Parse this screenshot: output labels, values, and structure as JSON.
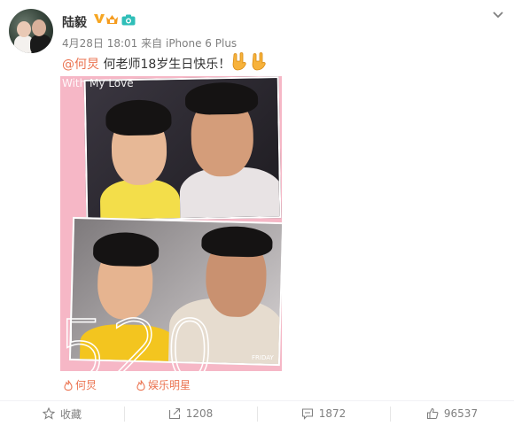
{
  "user": {
    "name": "陆毅",
    "verified_icon": "verified-v-icon",
    "level_icon": "vip-level-icon",
    "camera_icon": "camera-icon",
    "colors": {
      "verified": "#f6a623",
      "camera": "#2fbeb8"
    }
  },
  "post": {
    "date": "4月28日 18:01",
    "via_prefix": "来自",
    "device": "iPhone 6 Plus",
    "mention": "@何炅",
    "text": " 何老师18岁生日快乐！",
    "emojis": [
      "rock-hand-emoji-icon",
      "rock-hand-emoji-icon"
    ],
    "image": {
      "caption": "With My Love",
      "big_number": "520",
      "day": "FRIDAY",
      "background": "#f6b7c6"
    },
    "tags": [
      {
        "icon": "flame-icon",
        "label": "何炅"
      },
      {
        "icon": "flame-icon",
        "label": "娱乐明星"
      }
    ]
  },
  "actions": {
    "favorite": {
      "icon": "star-icon",
      "label": "收藏"
    },
    "repost": {
      "icon": "repost-icon",
      "count": "1208"
    },
    "comment": {
      "icon": "comment-icon",
      "count": "1872"
    },
    "like": {
      "icon": "thumbs-up-icon",
      "count": "96537"
    }
  },
  "colors": {
    "accent": "#eb7350",
    "muted": "#808080",
    "text": "#333333"
  }
}
